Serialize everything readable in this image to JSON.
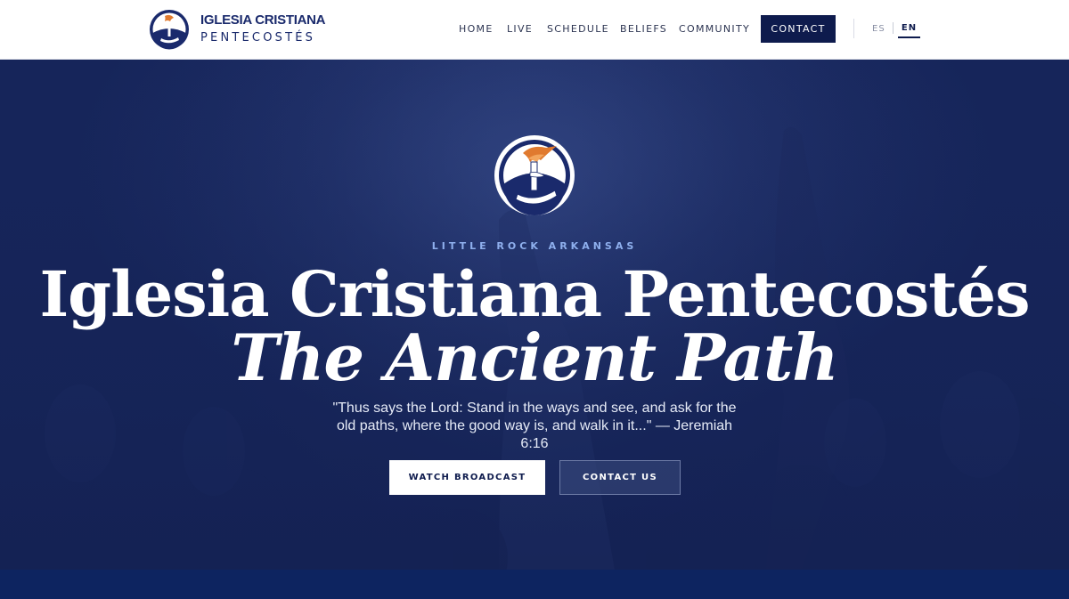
{
  "brand": {
    "name_line1": "IGLESIA CRISTIANA",
    "name_line2": "PENTECOSTÉS"
  },
  "nav": {
    "items": [
      {
        "label": "HOME"
      },
      {
        "label": "LIVE"
      },
      {
        "label": "SCHEDULE"
      },
      {
        "label": "BELIEFS"
      },
      {
        "label": "COMMUNITY"
      }
    ],
    "contact_label": "CONTACT",
    "languages": {
      "es": "ES",
      "en": "EN",
      "active": "EN"
    }
  },
  "hero": {
    "eyebrow": "LITTLE ROCK ARKANSAS",
    "title_line1": "Iglesia Cristiana Pentecostés",
    "title_line2": "The Ancient Path",
    "quote": "\"Thus says the Lord: Stand in the ways and see, and ask for the old paths, where the good way is, and walk in it...\" — Jeremiah 6:16",
    "primary_button": "WATCH BROADCAST",
    "secondary_button": "CONTACT US"
  },
  "icons": {
    "brand_logo": "torch-emblem-icon",
    "hero_logo": "torch-emblem-icon"
  },
  "colors": {
    "navy": "#0e1b4d",
    "brand_text": "#1a2a6c",
    "hero_bg": "#1e2e66",
    "eyebrow": "#8fb0ee",
    "flame": "#e07a2f"
  }
}
